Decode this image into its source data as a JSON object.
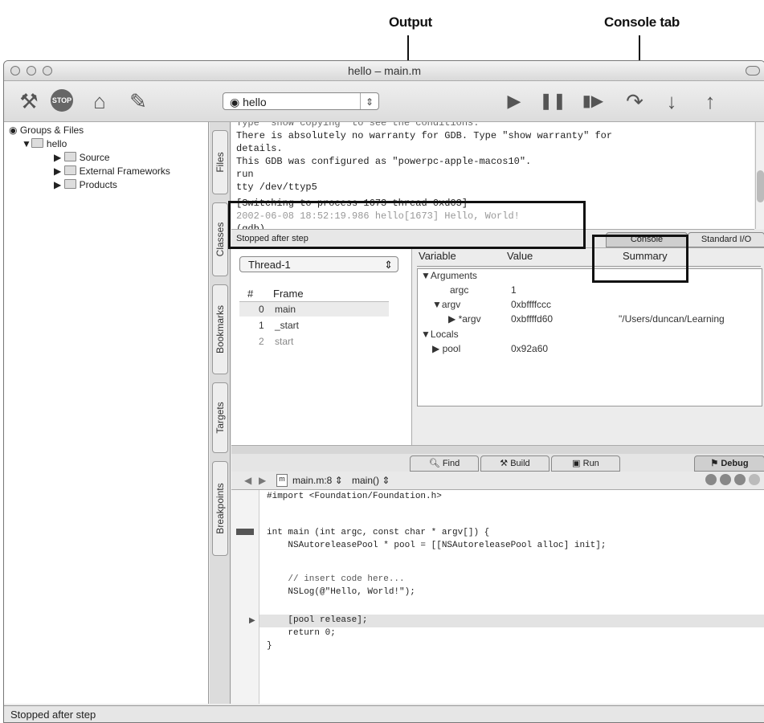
{
  "annotations": {
    "output": "Output",
    "console_tab": "Console tab"
  },
  "window": {
    "title": "hello – main.m"
  },
  "toolbar": {
    "target": "hello"
  },
  "groups": {
    "header": "Groups & Files",
    "project": "hello",
    "items": [
      "Source",
      "External Frameworks",
      "Products"
    ]
  },
  "side_tabs": [
    "Files",
    "Classes",
    "Bookmarks",
    "Targets",
    "Breakpoints"
  ],
  "console": {
    "lines": [
      "Type \"show copying\" to see the conditions.",
      "There is absolutely no warranty for GDB.  Type \"show warranty\" for",
      "details.",
      "This GDB was configured as \"powerpc-apple-macos10\".",
      "run",
      "tty /dev/ttyp5",
      "[Switching to process 1673 thread 0xd03]",
      "2002-06-08 18:52:19.986 hello[1673] Hello, World!",
      "(gdb)"
    ]
  },
  "debug_status": "Stopped after step",
  "console_tabs": {
    "console": "Console",
    "stdio": "Standard I/O"
  },
  "threads": {
    "selected": "Thread-1",
    "col_num": "#",
    "col_frame": "Frame",
    "frames": [
      {
        "num": "0",
        "name": "main"
      },
      {
        "num": "1",
        "name": "_start"
      },
      {
        "num": "2",
        "name": "start"
      }
    ]
  },
  "variables": {
    "col_var": "Variable",
    "col_val": "Value",
    "col_sum": "Summary",
    "arguments": "Arguments",
    "argc": "argc",
    "argc_val": "1",
    "argv": "argv",
    "argv_val": "0xbffffccc",
    "argv_star": "*argv",
    "argv_star_val": "0xbffffd60",
    "argv_star_sum": "\"/Users/duncan/Learning",
    "locals": "Locals",
    "pool": "pool",
    "pool_val": "0x92a60"
  },
  "bottom_tabs": {
    "find": "Find",
    "build": "Build",
    "run": "Run",
    "debug": "Debug"
  },
  "editor": {
    "file": "main.m:8",
    "func": "main()",
    "code": [
      "#import <Foundation/Foundation.h>",
      "",
      "int main (int argc, const char * argv[]) {",
      "    NSAutoreleasePool * pool = [[NSAutoreleasePool alloc] init];",
      "",
      "    // insert code here...",
      "    NSLog(@\"Hello, World!\");",
      "    [pool release];",
      "    return 0;",
      "}"
    ]
  },
  "status_bar": "Stopped after step"
}
